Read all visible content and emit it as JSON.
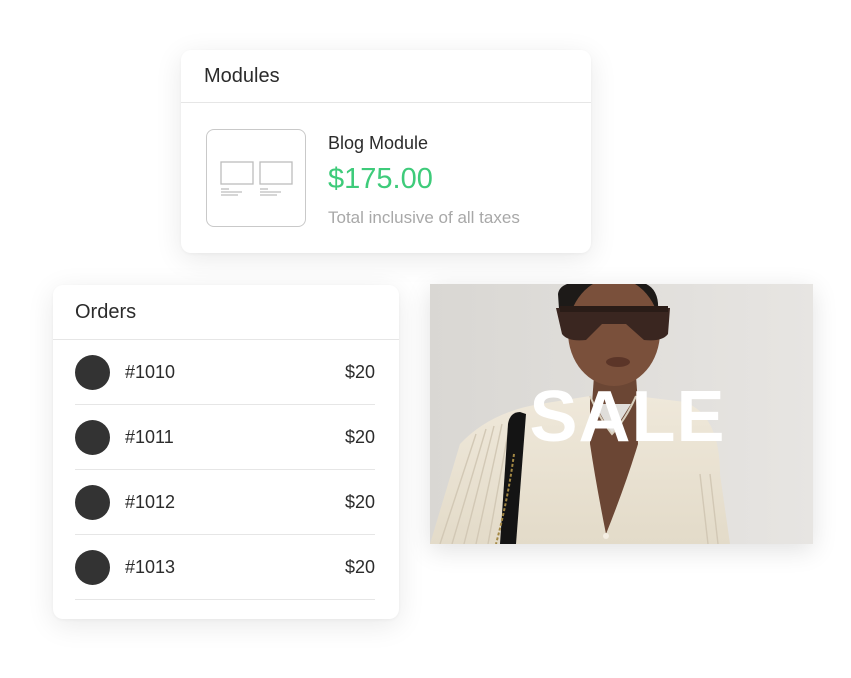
{
  "modules": {
    "title": "Modules",
    "item": {
      "name": "Blog Module",
      "price": "$175.00",
      "note": "Total inclusive of all taxes",
      "thumbnail_icon": "blog-layout-icon"
    },
    "price_color": "#3ecb7a"
  },
  "orders": {
    "title": "Orders",
    "rows": [
      {
        "id": "#1010",
        "amount": "$20"
      },
      {
        "id": "#1011",
        "amount": "$20"
      },
      {
        "id": "#1012",
        "amount": "$20"
      },
      {
        "id": "#1013",
        "amount": "$20"
      }
    ]
  },
  "banner": {
    "text": "SALE"
  }
}
